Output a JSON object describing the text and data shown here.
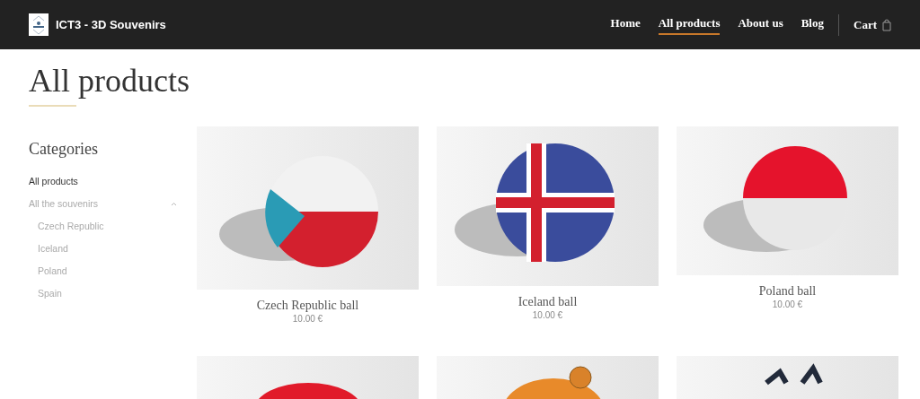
{
  "site": {
    "title": "ICT3 - 3D Souvenirs"
  },
  "nav": [
    {
      "label": "Home",
      "selected": false
    },
    {
      "label": "All products",
      "selected": true
    },
    {
      "label": "About us",
      "selected": false
    },
    {
      "label": "Blog",
      "selected": false
    }
  ],
  "cart": {
    "label": "Cart"
  },
  "page_title": "All products",
  "sidebar": {
    "title": "Categories",
    "items": [
      {
        "label": "All products",
        "selected": true
      },
      {
        "label": "All the souvenirs",
        "selected": false,
        "expanded": true,
        "children": [
          {
            "label": "Czech Republic",
            "selected": false
          },
          {
            "label": "Iceland",
            "selected": false
          },
          {
            "label": "Poland",
            "selected": false
          },
          {
            "label": "Spain",
            "selected": false
          }
        ]
      }
    ]
  },
  "products": [
    {
      "kind": "product",
      "name": "Czech Republic ball",
      "price": "10.00 €"
    },
    {
      "kind": "product",
      "name": "Iceland ball",
      "price": "10.00 €"
    },
    {
      "kind": "product",
      "name": "Poland ball",
      "price": "10.00 €"
    },
    {
      "kind": "picture"
    },
    {
      "kind": "picture"
    },
    {
      "kind": "picture"
    }
  ]
}
